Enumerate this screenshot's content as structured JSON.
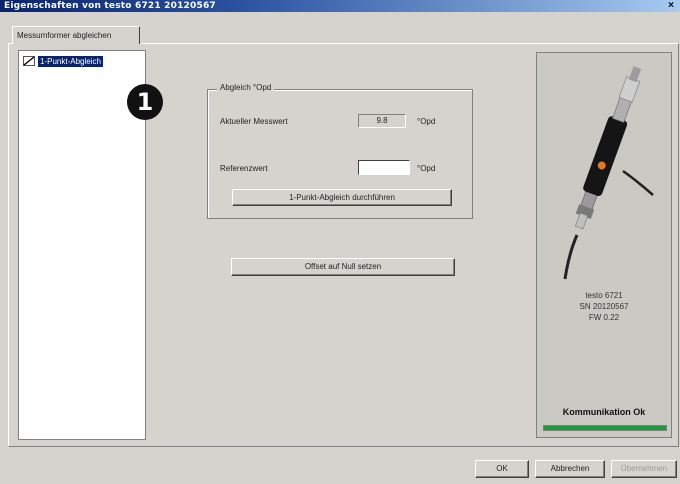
{
  "window": {
    "title": "Eigenschaften von testo 6721  20120567",
    "close_label": "×"
  },
  "tabs": [
    {
      "label": "Messumformer abgleichen"
    }
  ],
  "tree": {
    "items": [
      {
        "label": "1-Punkt-Abgleich"
      }
    ]
  },
  "callout": {
    "number": "1"
  },
  "group": {
    "legend": "Abgleich °Opd",
    "current_label": "Aktueller Messwert",
    "current_value": "9.8",
    "current_unit": "°Opd",
    "reference_label": "Referenzwert",
    "reference_value": "",
    "reference_unit": "°Opd",
    "run_button": "1-Punkt-Abgleich durchführen"
  },
  "offset_button": "Offset auf Null setzen",
  "device": {
    "model": "testo 6721",
    "serial": "SN 20120567",
    "firmware": "FW 0.22",
    "status": "Kommunikation Ok",
    "status_progress": 1.0
  },
  "footer": {
    "ok": "OK",
    "cancel": "Abbrechen",
    "apply": "Übernehmen"
  },
  "colors": {
    "status_green": "#1f9a3c",
    "titlebar": "#0a246a",
    "selection": "#0a246a"
  }
}
